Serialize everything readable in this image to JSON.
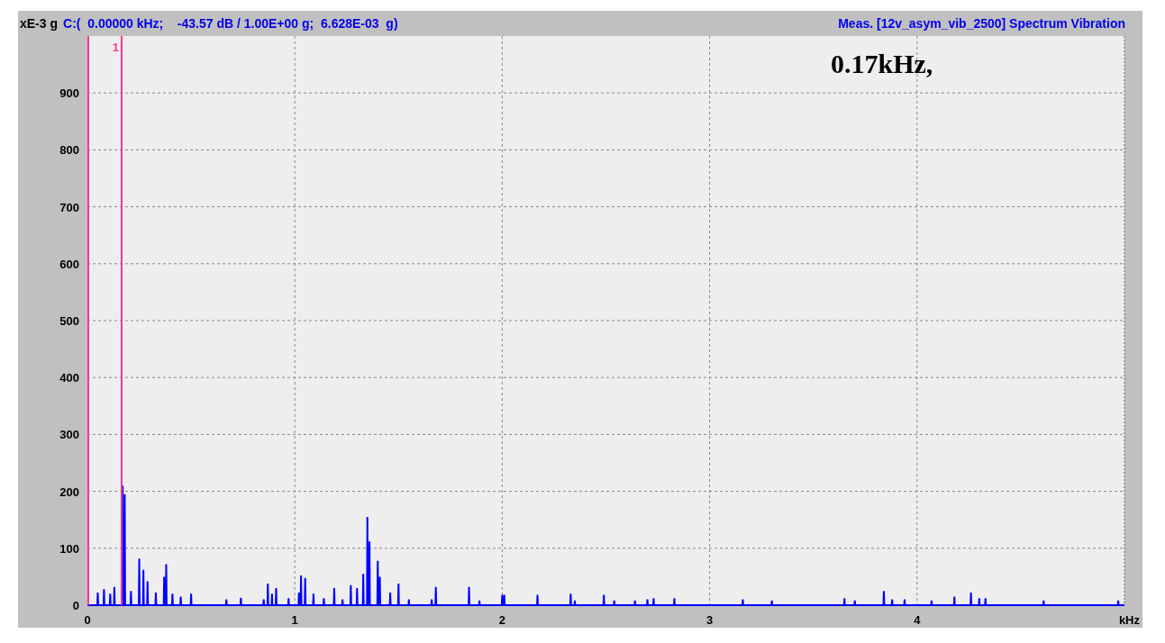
{
  "header": {
    "cursor_readout": "C:(  0.00000 kHz;    -43.57 dB / 1.00E+00 g;  6.628E-03  g)"
  },
  "overlay_text": "0.17kHz,",
  "marker": {
    "label": "1"
  },
  "cursor": {
    "visible": true
  },
  "chart_data": {
    "type": "line",
    "title": "Meas. [12v_asym_vib_2500] Spectrum Vibration",
    "xlabel": "kHz",
    "ylabel": "xE-3 g",
    "xlim": [
      0,
      5
    ],
    "ylim": [
      0,
      1000
    ],
    "grid": true,
    "xticks": [
      0,
      1,
      2,
      3,
      4
    ],
    "yticks": [
      0,
      100,
      200,
      300,
      400,
      500,
      600,
      700,
      800,
      900
    ],
    "x": [
      0,
      0.048,
      0.05,
      0.052,
      0.078,
      0.08,
      0.082,
      0.108,
      0.11,
      0.112,
      0.128,
      0.13,
      0.132,
      0.168,
      0.17,
      0.172,
      0.178,
      0.18,
      0.182,
      0.208,
      0.21,
      0.212,
      0.248,
      0.25,
      0.252,
      0.268,
      0.27,
      0.272,
      0.288,
      0.29,
      0.292,
      0.328,
      0.33,
      0.332,
      0.368,
      0.37,
      0.372,
      0.378,
      0.38,
      0.382,
      0.408,
      0.41,
      0.412,
      0.448,
      0.45,
      0.452,
      0.498,
      0.5,
      0.502,
      0.668,
      0.67,
      0.672,
      0.738,
      0.74,
      0.742,
      0.848,
      0.85,
      0.852,
      0.868,
      0.87,
      0.872,
      0.888,
      0.89,
      0.892,
      0.908,
      0.91,
      0.912,
      0.968,
      0.97,
      0.972,
      1.018,
      1.02,
      1.022,
      1.028,
      1.03,
      1.032,
      1.048,
      1.05,
      1.052,
      1.088,
      1.09,
      1.092,
      1.138,
      1.14,
      1.142,
      1.188,
      1.19,
      1.192,
      1.228,
      1.23,
      1.232,
      1.268,
      1.27,
      1.272,
      1.298,
      1.3,
      1.302,
      1.328,
      1.33,
      1.332,
      1.348,
      1.35,
      1.352,
      1.358,
      1.36,
      1.362,
      1.398,
      1.4,
      1.402,
      1.408,
      1.41,
      1.412,
      1.458,
      1.46,
      1.462,
      1.498,
      1.5,
      1.502,
      1.548,
      1.55,
      1.552,
      1.658,
      1.66,
      1.662,
      1.678,
      1.68,
      1.682,
      1.838,
      1.84,
      1.842,
      1.888,
      1.89,
      1.892,
      1.998,
      2.0,
      2.002,
      2.008,
      2.01,
      2.012,
      2.168,
      2.17,
      2.172,
      2.328,
      2.33,
      2.332,
      2.348,
      2.35,
      2.352,
      2.488,
      2.49,
      2.492,
      2.538,
      2.54,
      2.542,
      2.638,
      2.64,
      2.642,
      2.698,
      2.7,
      2.702,
      2.728,
      2.73,
      2.732,
      2.828,
      2.83,
      2.832,
      3.158,
      3.16,
      3.162,
      3.298,
      3.3,
      3.302,
      3.648,
      3.65,
      3.652,
      3.698,
      3.7,
      3.702,
      3.838,
      3.84,
      3.842,
      3.878,
      3.88,
      3.882,
      3.938,
      3.94,
      3.942,
      4.068,
      4.07,
      4.072,
      4.178,
      4.18,
      4.182,
      4.258,
      4.26,
      4.262,
      4.298,
      4.3,
      4.302,
      4.328,
      4.33,
      4.332,
      4.608,
      4.61,
      4.612,
      4.968,
      4.97,
      4.972,
      5
    ],
    "series": [
      {
        "color": "#0000ff",
        "values": [
          0,
          0,
          22,
          0,
          0,
          28,
          0,
          0,
          20,
          0,
          0,
          32,
          0,
          0,
          210,
          0,
          0,
          195,
          0,
          0,
          25,
          0,
          0,
          82,
          0,
          0,
          62,
          0,
          0,
          42,
          0,
          0,
          22,
          0,
          0,
          50,
          0,
          0,
          72,
          0,
          0,
          20,
          0,
          0,
          15,
          0,
          0,
          20,
          0,
          0,
          10,
          0,
          0,
          13,
          0,
          0,
          10,
          0,
          0,
          38,
          0,
          0,
          20,
          0,
          0,
          30,
          0,
          0,
          12,
          0,
          0,
          22,
          0,
          0,
          52,
          0,
          0,
          48,
          0,
          0,
          20,
          0,
          0,
          12,
          0,
          0,
          30,
          0,
          0,
          10,
          0,
          0,
          35,
          0,
          0,
          30,
          0,
          0,
          55,
          0,
          0,
          155,
          0,
          0,
          112,
          0,
          0,
          78,
          0,
          0,
          50,
          0,
          0,
          22,
          0,
          0,
          38,
          0,
          0,
          10,
          0,
          0,
          10,
          0,
          0,
          32,
          0,
          0,
          32,
          0,
          0,
          8,
          0,
          0,
          18,
          0,
          0,
          18,
          0,
          0,
          18,
          0,
          0,
          20,
          0,
          0,
          8,
          0,
          0,
          18,
          0,
          0,
          8,
          0,
          0,
          8,
          0,
          0,
          10,
          0,
          0,
          12,
          0,
          0,
          12,
          0,
          0,
          10,
          0,
          0,
          8,
          0,
          0,
          12,
          0,
          0,
          8,
          0,
          0,
          25,
          0,
          0,
          10,
          0,
          0,
          10,
          0,
          0,
          8,
          0,
          0,
          15,
          0,
          0,
          22,
          0,
          0,
          12,
          0,
          0,
          12,
          0,
          0,
          8,
          0,
          0,
          8,
          0,
          0
        ]
      }
    ],
    "ref_lines": [
      {
        "axis": "x",
        "value": 0.165,
        "color": "#ff3399"
      }
    ]
  }
}
